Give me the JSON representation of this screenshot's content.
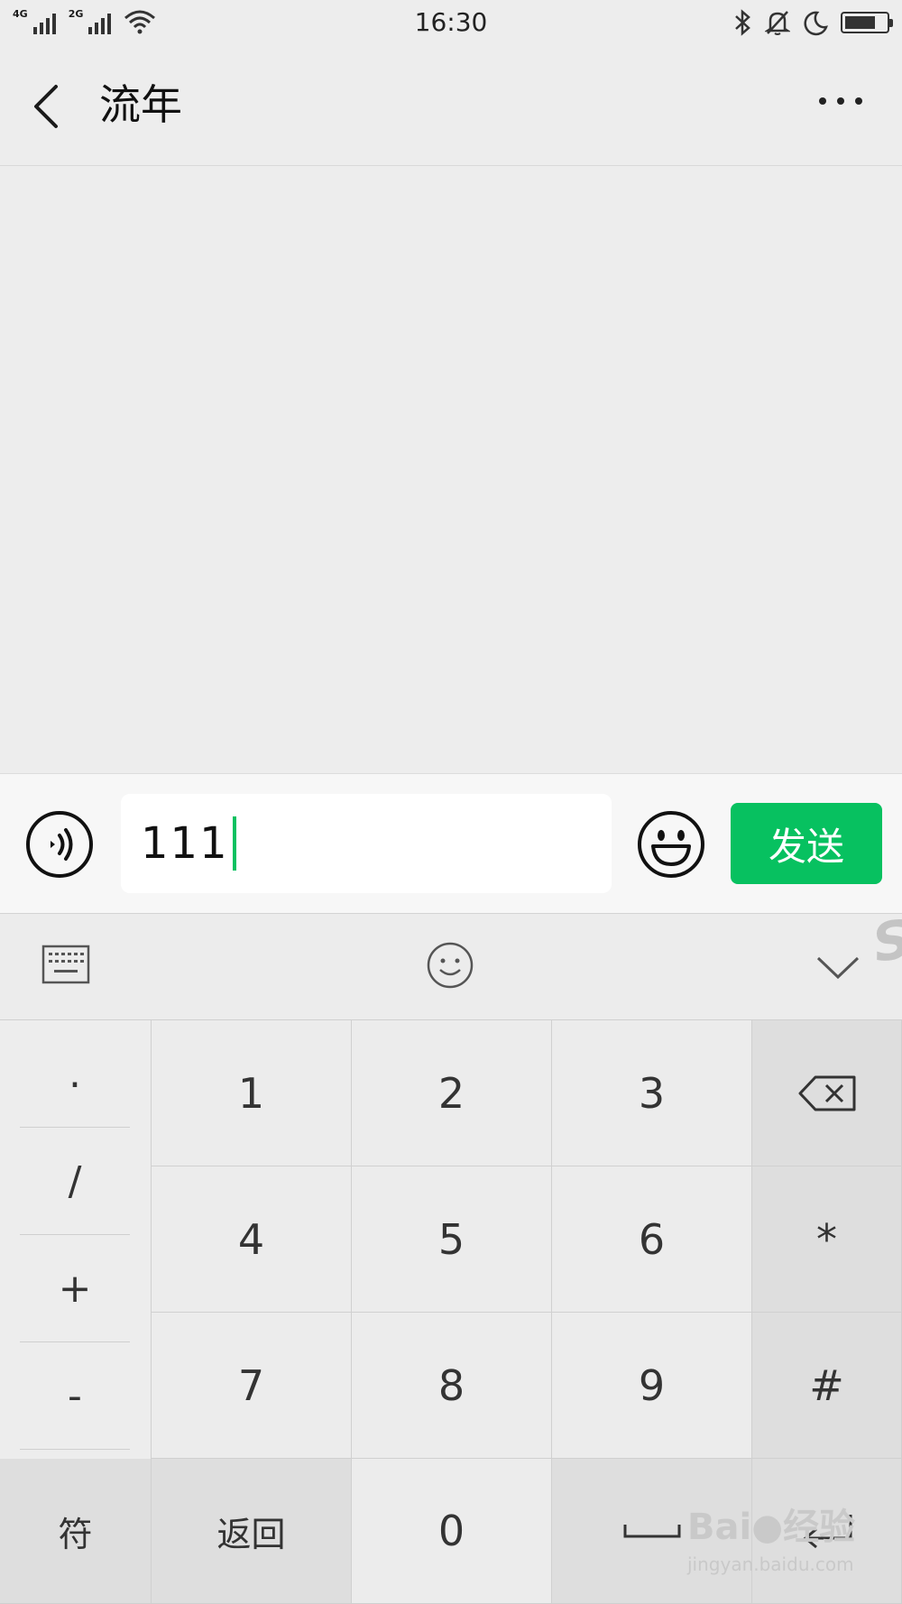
{
  "status_bar": {
    "network1": "4G",
    "network2": "2G",
    "time": "16:30",
    "battery_level": 0.75,
    "icons": [
      "signal-icon",
      "wifi-icon",
      "bluetooth-icon",
      "bell-muted-icon",
      "moon-icon",
      "battery-icon"
    ]
  },
  "header": {
    "title": "流年"
  },
  "input_bar": {
    "text_value": "111",
    "send_label": "发送",
    "accent_color": "#07c160"
  },
  "keyboard": {
    "symbol_keys": [
      ".",
      "/",
      "+",
      "-"
    ],
    "number_rows": [
      [
        "1",
        "2",
        "3"
      ],
      [
        "4",
        "5",
        "6"
      ],
      [
        "7",
        "8",
        "9"
      ]
    ],
    "right_keys": [
      "*",
      "#"
    ],
    "bottom": {
      "symbols_label": "符",
      "back_label": "返回",
      "zero_label": "0"
    }
  },
  "watermark": {
    "logo": "Bai●经验",
    "url": "jingyan.baidu.com"
  }
}
